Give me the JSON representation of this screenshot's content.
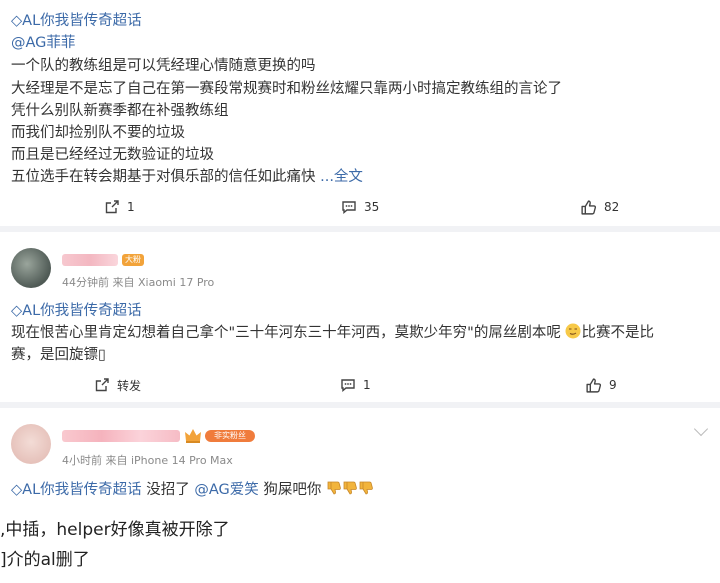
{
  "post1": {
    "lines": [
      "◇AL你我皆传奇超话",
      "@AG菲菲",
      "一个队的教练组是可以凭经理心情随意更换的吗",
      "大经理是不是忘了自己在第一赛段常规赛时和粉丝炫耀只靠两小时搞定教练组的言论了",
      "凭什么别队新赛季都在补强教练组",
      "而我们却捡别队不要的垃圾",
      "而且是已经经过无数验证的垃圾",
      "五位选手在转会期基于对俱乐部的信任如此痛快"
    ],
    "more": " ...全文",
    "actions": {
      "repost": "1",
      "comment": "35",
      "like": "82"
    }
  },
  "post2": {
    "badge": "大粉",
    "meta": "44分钟前  来自 Xiaomi 17 Pro",
    "topic": "◇AL你我皆传奇超话",
    "text_line1": "现在恨苦心里肯定幻想着自己拿个\"三十年河东三十年河西，莫欺少年穷\"的屌丝剧本呢",
    "text_line1_end": "比赛不是比",
    "text_line2": "赛，是回旋镖▯",
    "actions": {
      "repost": "转发",
      "comment": "1",
      "like": "9"
    }
  },
  "post3": {
    "badge": "非实粉丝",
    "meta": "4小时前  来自 iPhone 14 Pro Max",
    "topic": "◇AL你我皆传奇超话",
    "text_a": " 没招了 ",
    "mention": "@AG爱笑",
    "text_b": " 狗屎吧你",
    "big1": ",中插，helper好像真被开除了",
    "big2": "]介的al删了"
  }
}
